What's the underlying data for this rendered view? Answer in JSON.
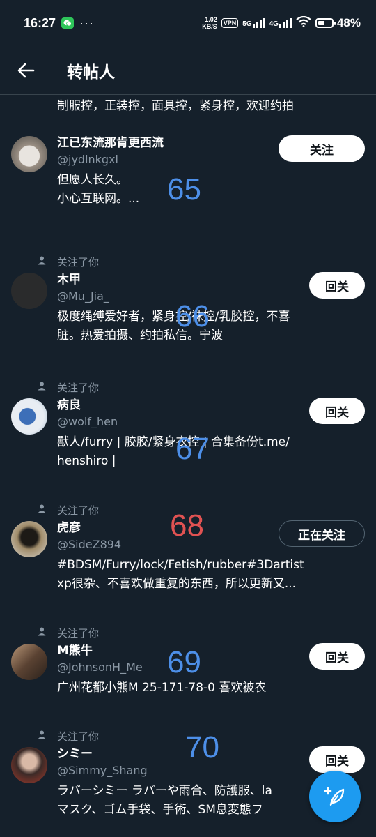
{
  "status_bar": {
    "time": "16:27",
    "more": "···",
    "speed_value": "1.02",
    "speed_unit": "KB/S",
    "vpn": "VPN",
    "net1": "5G",
    "net2": "4G",
    "battery": "48%",
    "battery_level": 0.48
  },
  "header": {
    "title": "转帖人",
    "back_icon": "arrow-left-icon"
  },
  "top_bio": "制服控，正装控，面具控，紧身控，欢迎约拍",
  "users": [
    {
      "note": "",
      "name": "江已东流那肯更西流",
      "handle": "@jydlnkgxl",
      "button": "关注",
      "button_style": "light",
      "bio": [
        "但愿人长久。",
        "小心互联网。..."
      ],
      "overlay": "65",
      "overlay_color": "#4d8fe8"
    },
    {
      "note": "关注了你",
      "name": "木甲",
      "handle": "@Mu_Jia_",
      "button": "回关",
      "button_style": "light",
      "bio": [
        "极度绳缚爱好者，紧身控/袜控/乳胶控，不喜",
        "脏。热爱拍摄、约拍私信。宁波"
      ],
      "overlay": "66",
      "overlay_color": "#4d8fe8"
    },
    {
      "note": "关注了你",
      "name": "病良",
      "handle": "@wolf_hen",
      "button": "回关",
      "button_style": "light",
      "bio": [
        "獸人/furry | 胶胶/紧身衣控 |  合集备份t.me/",
        "henshiro |"
      ],
      "overlay": "67",
      "overlay_color": "#4d8fe8"
    },
    {
      "note": "关注了你",
      "name": "虎彦",
      "handle": "@SideZ894",
      "button": "正在关注",
      "button_style": "outline",
      "bio": [
        "#BDSM/Furry/lock/Fetish/rubber#3Dartist",
        "  xp很杂、不喜欢做重复的东西，所以更新又..."
      ],
      "overlay": "68",
      "overlay_color": "#e05252"
    },
    {
      "note": "关注了你",
      "name": "M熊牛",
      "handle": "@JohnsonH_Me",
      "button": "回关",
      "button_style": "light",
      "bio": [
        "广州花都小熊M 25-171-78-0 喜欢被农"
      ],
      "overlay": "69",
      "overlay_color": "#4d8fe8"
    },
    {
      "note": "关注了你",
      "name": "シミー",
      "handle": "@Simmy_Shang",
      "button": "回关",
      "button_style": "light",
      "bio": [
        "ラバーシミー ラバーや雨合、防護服、la",
        "マスク、ゴム手袋、手術、SM息変態フ"
      ],
      "overlay": "70",
      "overlay_color": "#4d8fe8"
    }
  ],
  "fab_icon": "compose-plus-feather-icon"
}
